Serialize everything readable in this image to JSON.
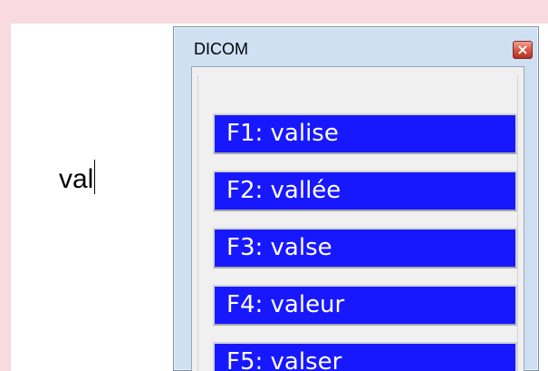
{
  "document": {
    "typed_text": "val"
  },
  "dialog": {
    "title": "DICOM",
    "close_label": "×"
  },
  "suggestions": [
    {
      "label": "F1: valise"
    },
    {
      "label": "F2: vallée"
    },
    {
      "label": "F3: valse"
    },
    {
      "label": "F4: valeur"
    },
    {
      "label": "F5: valser"
    }
  ],
  "colors": {
    "background": "#f7dbe1",
    "document": "#ffffff",
    "dialog_frame": "#cfe0f3",
    "suggestion_bg": "#1818ff",
    "suggestion_text": "#ffffff"
  }
}
